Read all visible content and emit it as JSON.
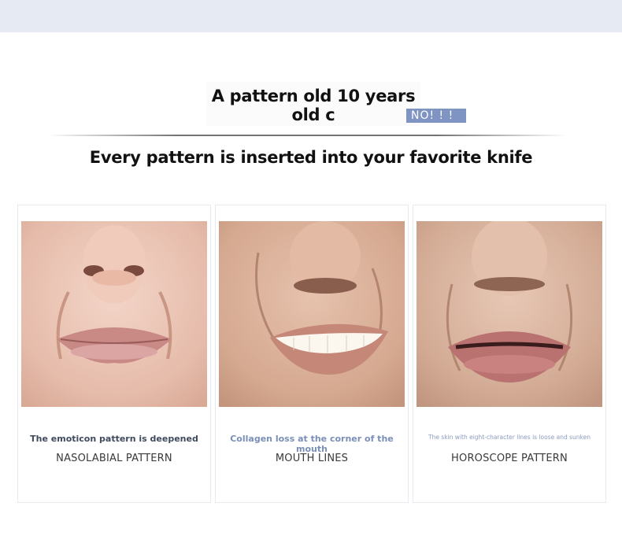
{
  "header": {
    "line1": "A pattern old 10 years",
    "line2": "old c",
    "badge": "NO! ! !",
    "subtitle": "Every pattern is inserted into your favorite knife"
  },
  "cards": [
    {
      "caption": "The emoticon pattern is deepened",
      "name": "NASOLABIAL PATTERN",
      "caption_color": "#3f4a5e"
    },
    {
      "caption": "Collagen loss at the corner of the mouth",
      "name": "MOUTH LINES",
      "caption_color": "#7a8fb8"
    },
    {
      "caption": "The skin with eight-character lines is loose and sunken",
      "name": "HOROSCOPE PATTERN",
      "caption_color": "#8a9bbf"
    }
  ],
  "colors": {
    "top_band": "#e6eaf3",
    "badge_bg": "#7f94c2"
  }
}
